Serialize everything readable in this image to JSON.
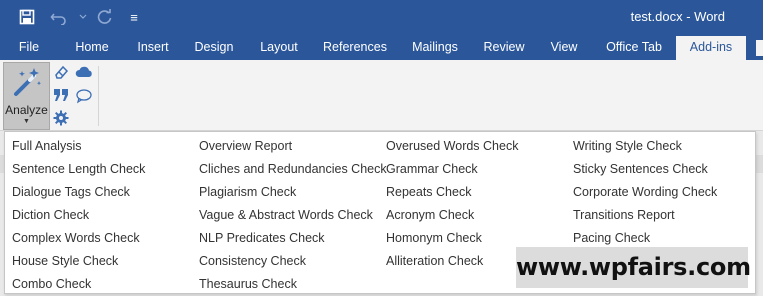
{
  "title_bar": {
    "title": "test.docx - Word",
    "qat_icons": [
      "save-icon",
      "undo-icon",
      "redo-icon",
      "customize-qat-icon"
    ],
    "qat_customize_glyph": "≡"
  },
  "tabs": [
    {
      "label": "File"
    },
    {
      "label": "Home"
    },
    {
      "label": "Insert"
    },
    {
      "label": "Design"
    },
    {
      "label": "Layout"
    },
    {
      "label": "References"
    },
    {
      "label": "Mailings"
    },
    {
      "label": "Review"
    },
    {
      "label": "View"
    },
    {
      "label": "Office Tab"
    },
    {
      "label": "Add-ins",
      "active": true
    }
  ],
  "ribbon": {
    "analyze_label": "Analyze",
    "analyze_caret": "▼",
    "small_icons": [
      "eraser-icon",
      "cloud-icon",
      "quote-icon",
      "comment-icon",
      "gear-icon"
    ]
  },
  "menu": {
    "columns": [
      [
        "Full Analysis",
        "Sentence Length Check",
        "Dialogue Tags Check",
        "Diction Check",
        "Complex Words Check",
        "House Style Check",
        "Combo Check"
      ],
      [
        "Overview Report",
        "Cliches and Redundancies Check",
        "Plagiarism Check",
        "Vague & Abstract Words Check",
        "NLP Predicates Check",
        "Consistency Check",
        "Thesaurus Check"
      ],
      [
        "Overused Words Check",
        "Grammar Check",
        "Repeats Check",
        "Acronym Check",
        "Homonym Check",
        "Alliteration Check"
      ],
      [
        "Writing Style Check",
        "Sticky Sentences Check",
        "Corporate Wording Check",
        "Transitions Report",
        "Pacing Check"
      ]
    ]
  },
  "watermark": {
    "text": "www.wpfairs.com"
  },
  "colors": {
    "accent": "#2b579a",
    "icon_blue": "#3d6fb5",
    "menu_text": "#333333"
  }
}
